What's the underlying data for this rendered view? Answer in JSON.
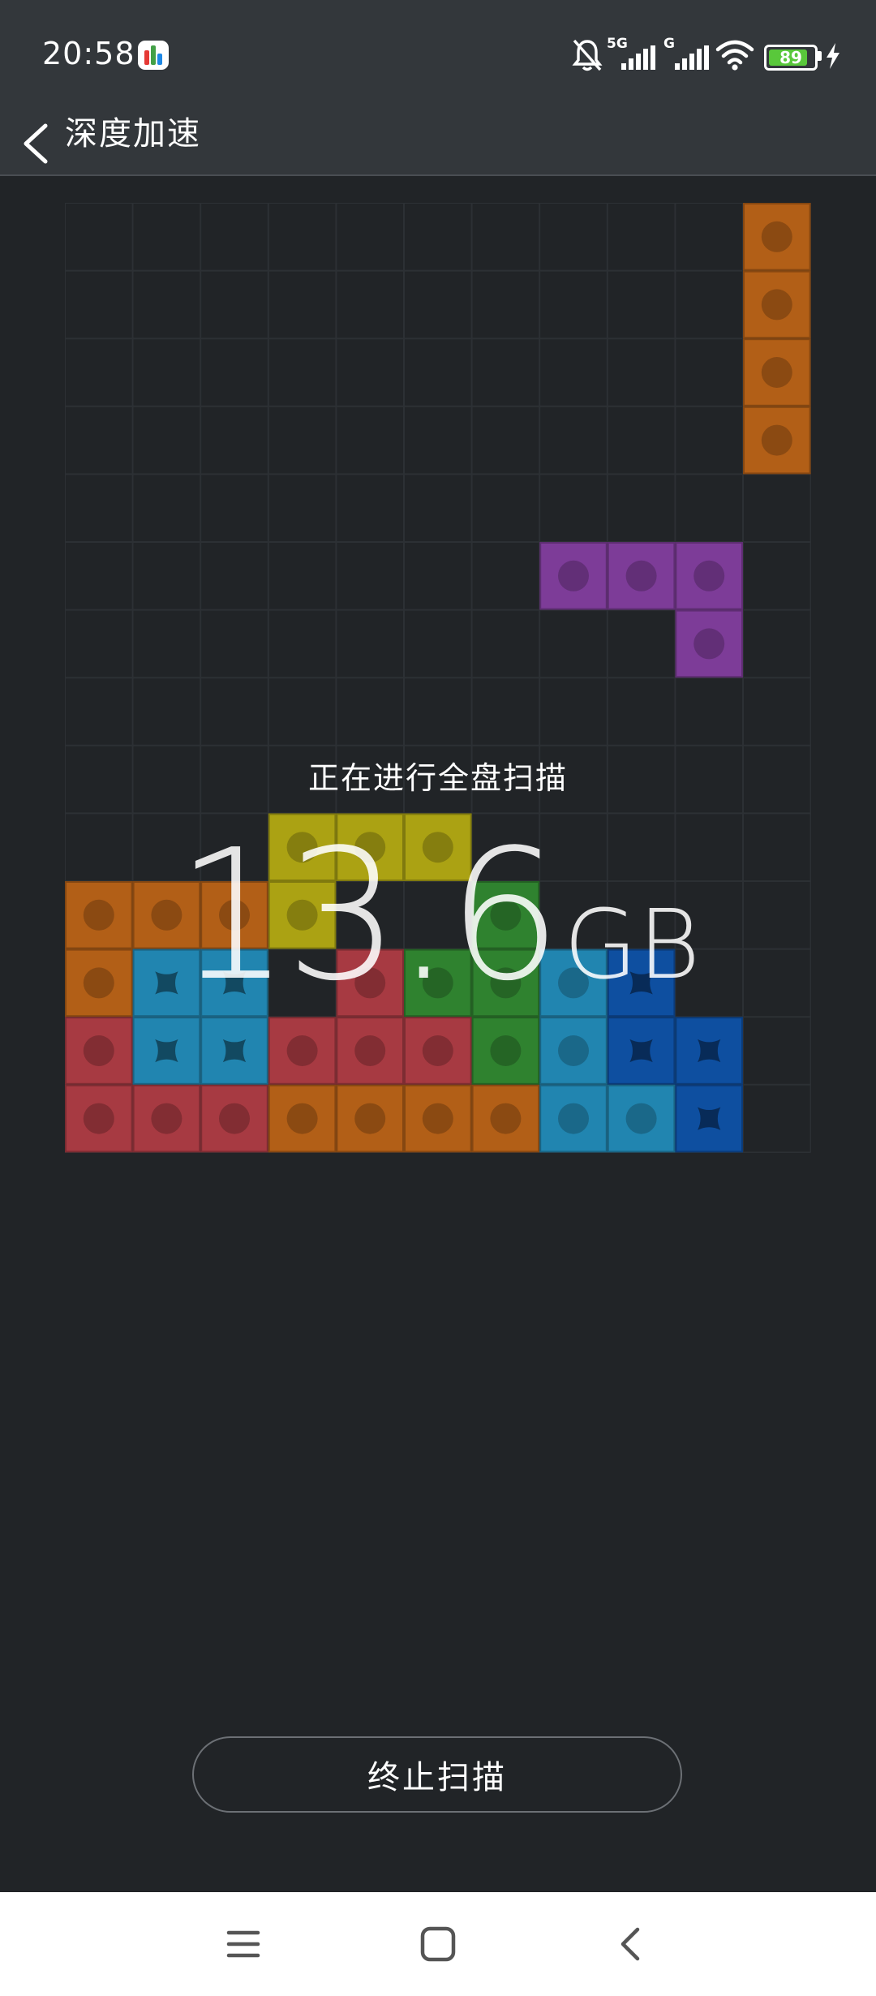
{
  "status_bar": {
    "time": "20:58",
    "network_1": "5G",
    "network_2": "G",
    "battery": "89",
    "icons": [
      "app-notification-icon",
      "mute-icon",
      "signal-5g-icon",
      "signal-g-icon",
      "wifi-icon",
      "battery-icon",
      "charging-icon"
    ]
  },
  "header": {
    "title": "深度加速",
    "back_icon": "back-chevron-icon"
  },
  "scan": {
    "status": "正在进行全盘扫描",
    "size_value": "13.6",
    "size_unit": "GB"
  },
  "actions": {
    "stop_label": "终止扫描"
  },
  "nav_bar": {
    "icons": [
      "menu-icon",
      "home-icon",
      "back-icon"
    ]
  },
  "board": {
    "columns": 11,
    "rows": 14,
    "colors": {
      "orange": "#b25f17",
      "purple": "#7d3c98",
      "yellow": "#aba213",
      "green": "#2f822f",
      "red": "#a73a42",
      "teal": "#2185b0",
      "blue": "#0e4fa0",
      "grid_line": "#2c3034"
    },
    "blocks": [
      {
        "c": 10,
        "r": 0,
        "color": "orange",
        "mark": "dot"
      },
      {
        "c": 10,
        "r": 1,
        "color": "orange",
        "mark": "dot"
      },
      {
        "c": 10,
        "r": 2,
        "color": "orange",
        "mark": "dot"
      },
      {
        "c": 10,
        "r": 3,
        "color": "orange",
        "mark": "dot"
      },
      {
        "c": 7,
        "r": 5,
        "color": "purple",
        "mark": "dot"
      },
      {
        "c": 8,
        "r": 5,
        "color": "purple",
        "mark": "dot"
      },
      {
        "c": 9,
        "r": 5,
        "color": "purple",
        "mark": "dot"
      },
      {
        "c": 9,
        "r": 6,
        "color": "purple",
        "mark": "dot"
      },
      {
        "c": 3,
        "r": 9,
        "color": "yellow",
        "mark": "dot"
      },
      {
        "c": 4,
        "r": 9,
        "color": "yellow",
        "mark": "dot"
      },
      {
        "c": 5,
        "r": 9,
        "color": "yellow",
        "mark": "dot"
      },
      {
        "c": 3,
        "r": 10,
        "color": "yellow",
        "mark": "dot"
      },
      {
        "c": 0,
        "r": 10,
        "color": "orange",
        "mark": "dot"
      },
      {
        "c": 1,
        "r": 10,
        "color": "orange",
        "mark": "dot"
      },
      {
        "c": 2,
        "r": 10,
        "color": "orange",
        "mark": "dot"
      },
      {
        "c": 6,
        "r": 10,
        "color": "green",
        "mark": "dot"
      },
      {
        "c": 0,
        "r": 11,
        "color": "orange",
        "mark": "dot"
      },
      {
        "c": 1,
        "r": 11,
        "color": "teal",
        "mark": "star"
      },
      {
        "c": 2,
        "r": 11,
        "color": "teal",
        "mark": "star"
      },
      {
        "c": 4,
        "r": 11,
        "color": "red",
        "mark": "dot"
      },
      {
        "c": 5,
        "r": 11,
        "color": "green",
        "mark": "dot"
      },
      {
        "c": 6,
        "r": 11,
        "color": "green",
        "mark": "dot"
      },
      {
        "c": 7,
        "r": 11,
        "color": "teal",
        "mark": "dot"
      },
      {
        "c": 8,
        "r": 11,
        "color": "blue",
        "mark": "star"
      },
      {
        "c": 0,
        "r": 12,
        "color": "red",
        "mark": "dot"
      },
      {
        "c": 1,
        "r": 12,
        "color": "teal",
        "mark": "star"
      },
      {
        "c": 2,
        "r": 12,
        "color": "teal",
        "mark": "star"
      },
      {
        "c": 3,
        "r": 12,
        "color": "red",
        "mark": "dot"
      },
      {
        "c": 4,
        "r": 12,
        "color": "red",
        "mark": "dot"
      },
      {
        "c": 5,
        "r": 12,
        "color": "red",
        "mark": "dot"
      },
      {
        "c": 6,
        "r": 12,
        "color": "green",
        "mark": "dot"
      },
      {
        "c": 7,
        "r": 12,
        "color": "teal",
        "mark": "dot"
      },
      {
        "c": 8,
        "r": 12,
        "color": "blue",
        "mark": "star"
      },
      {
        "c": 9,
        "r": 12,
        "color": "blue",
        "mark": "star"
      },
      {
        "c": 0,
        "r": 13,
        "color": "red",
        "mark": "dot"
      },
      {
        "c": 1,
        "r": 13,
        "color": "red",
        "mark": "dot"
      },
      {
        "c": 2,
        "r": 13,
        "color": "red",
        "mark": "dot"
      },
      {
        "c": 3,
        "r": 13,
        "color": "orange",
        "mark": "dot"
      },
      {
        "c": 4,
        "r": 13,
        "color": "orange",
        "mark": "dot"
      },
      {
        "c": 5,
        "r": 13,
        "color": "orange",
        "mark": "dot"
      },
      {
        "c": 6,
        "r": 13,
        "color": "orange",
        "mark": "dot"
      },
      {
        "c": 7,
        "r": 13,
        "color": "teal",
        "mark": "dot"
      },
      {
        "c": 8,
        "r": 13,
        "color": "teal",
        "mark": "dot"
      },
      {
        "c": 9,
        "r": 13,
        "color": "blue",
        "mark": "star"
      }
    ]
  }
}
